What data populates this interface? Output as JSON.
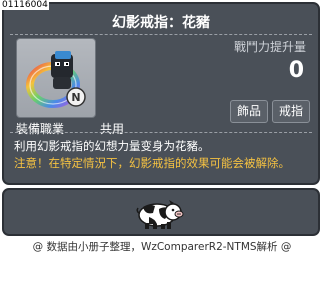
{
  "item": {
    "id": "01116004",
    "name": "幻影戒指：花豬",
    "power_label": "戰鬥力提升量",
    "power_value": "0",
    "tags": [
      "飾品",
      "戒指"
    ],
    "job_label": "裝備職業",
    "job_value": "共用",
    "description": "利用幻影戒指的幻想力量变身为花豬。",
    "warning": "注意！在特定情況下，幻影戒指的效果可能会被解除。"
  },
  "preview": {
    "sprite_icon": "spotted-pig-sprite"
  },
  "footer": {
    "credit": "@ 数据由小册子整理，WzComparerR2-NTMS解析 @"
  },
  "colors": {
    "panel_bg": "#4a5058",
    "panel_border": "#2c3036",
    "name_text": "#ffffff",
    "warning_text": "#f5c242",
    "label_text": "#ced2d8"
  }
}
